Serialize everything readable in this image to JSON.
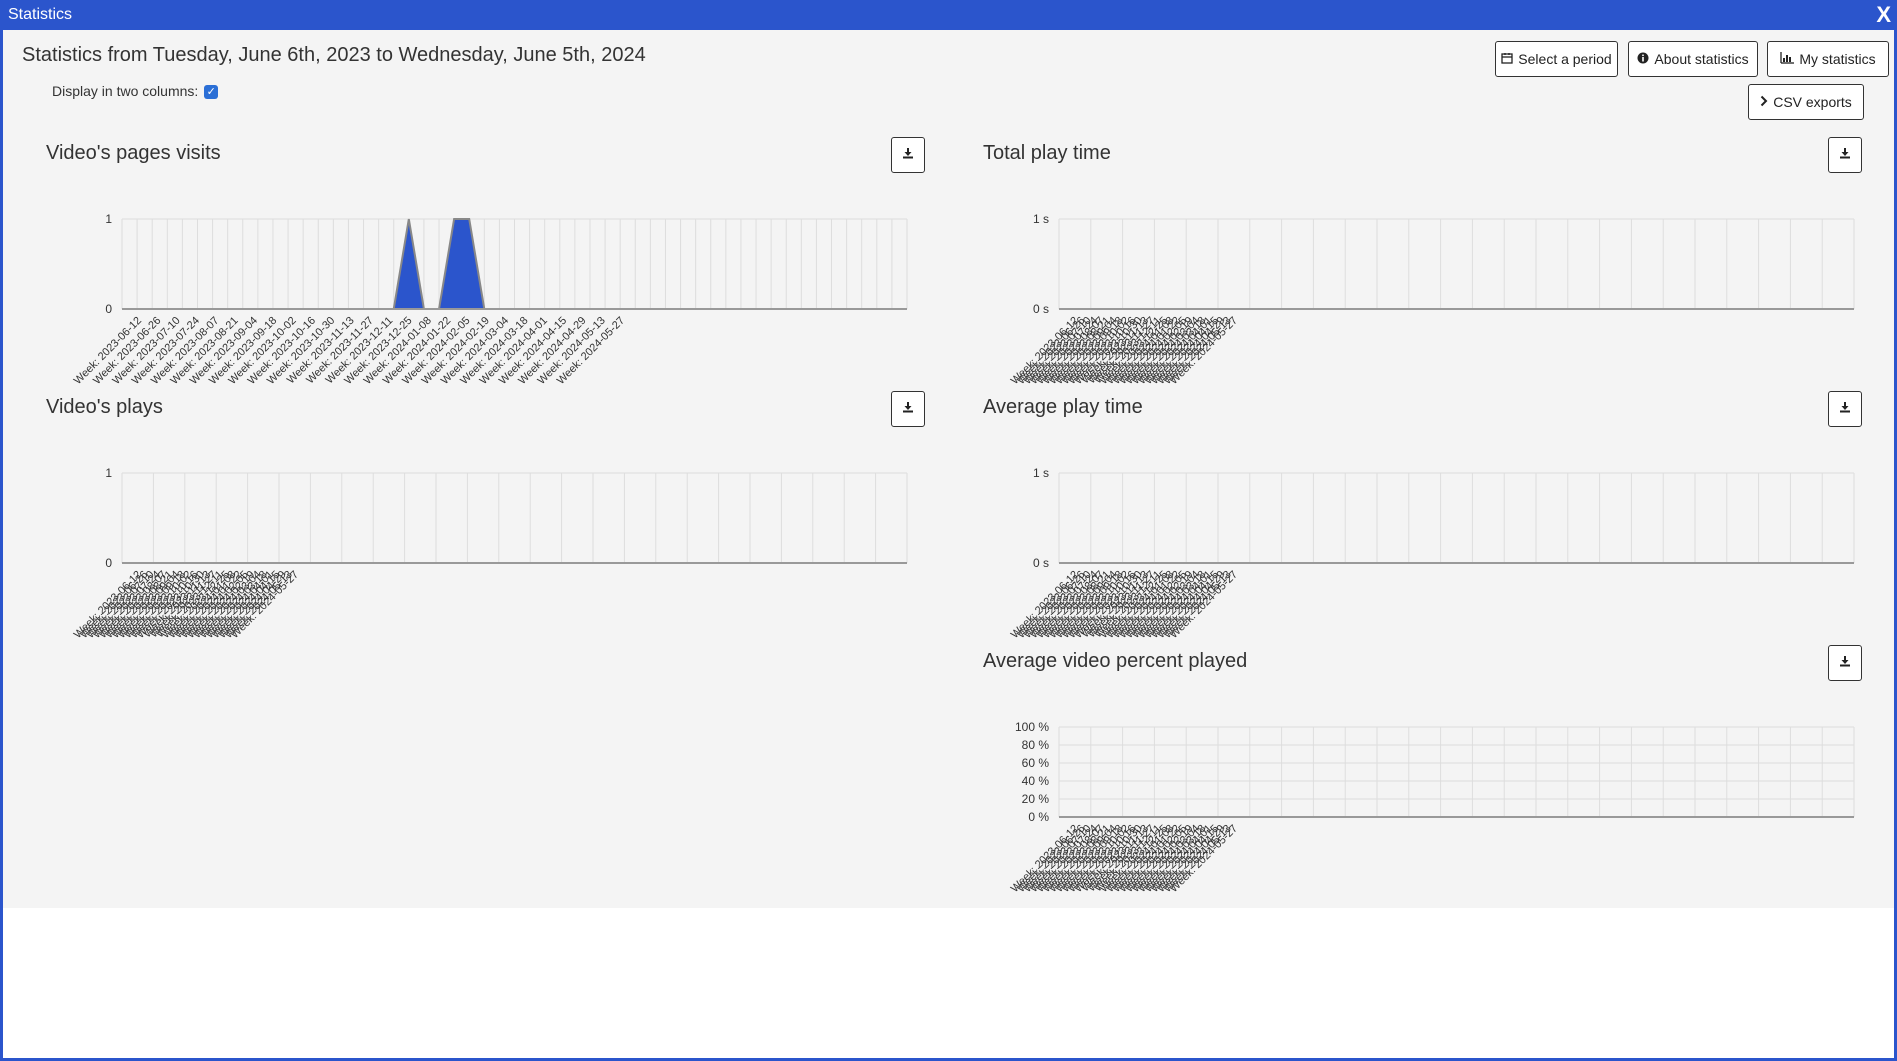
{
  "window": {
    "title": "Statistics",
    "close_label": "X"
  },
  "page": {
    "heading": "Statistics from Tuesday, June 6th, 2023 to Wednesday, June 5th, 2024",
    "two_columns_label": "Display in two columns:",
    "two_columns_checked": true
  },
  "buttons": {
    "select_period": "Select a period",
    "about_statistics": "About statistics",
    "my_statistics": "My statistics",
    "csv_exports": "CSV exports"
  },
  "icons": {
    "select_period": "calendar-icon",
    "about_statistics": "info-circle-icon",
    "my_statistics": "bar-chart-icon",
    "csv_exports": "chevron-right-icon",
    "download": "download-icon"
  },
  "colors": {
    "title_bar": "#2b55cc",
    "series_fill": "#2b55cc",
    "series_stroke": "#888888",
    "grid": "#dddddd",
    "axis": "#999999"
  },
  "chart_data": [
    {
      "id": "page-visits",
      "type": "area",
      "title": "Video's pages visits",
      "xlabel": "",
      "ylabel": "",
      "ylim": [
        0,
        1
      ],
      "yticks": [
        "0",
        "1"
      ],
      "x": [
        "Week: 2023-06-12",
        "Week: 2023-06-26",
        "Week: 2023-07-10",
        "Week: 2023-07-24",
        "Week: 2023-08-07",
        "Week: 2023-08-21",
        "Week: 2023-09-04",
        "Week: 2023-09-18",
        "Week: 2023-10-02",
        "Week: 2023-10-16",
        "Week: 2023-10-30",
        "Week: 2023-11-13",
        "Week: 2023-11-27",
        "Week: 2023-12-11",
        "Week: 2023-12-25",
        "Week: 2024-01-08",
        "Week: 2024-01-22",
        "Week: 2024-02-05",
        "Week: 2024-02-19",
        "Week: 2024-03-04",
        "Week: 2024-03-18",
        "Week: 2024-04-01",
        "Week: 2024-04-15",
        "Week: 2024-04-29",
        "Week: 2024-05-13",
        "Week: 2024-05-27"
      ],
      "series": [
        {
          "values": [
            0,
            0,
            0,
            0,
            0,
            0,
            0,
            0,
            0,
            0,
            0,
            0,
            0,
            0,
            0,
            0,
            0,
            0,
            0,
            1,
            0,
            0,
            1,
            1,
            0,
            0,
            0,
            0,
            0,
            0,
            0,
            0,
            0,
            0,
            0,
            0,
            0,
            0,
            0,
            0,
            0,
            0,
            0,
            0,
            0,
            0,
            0,
            0,
            0,
            0,
            0,
            0,
            0
          ]
        }
      ],
      "grid": true,
      "legend": "none"
    },
    {
      "id": "total-play-time",
      "type": "area",
      "title": "Total play time",
      "xlabel": "",
      "ylabel": "",
      "ylim": [
        0,
        1
      ],
      "yticks": [
        "0 s",
        "1 s"
      ],
      "x": [
        "Week: 2023-06-12",
        "Week: 2023-06-26",
        "Week: 2023-07-10",
        "Week: 2023-07-24",
        "Week: 2023-08-07",
        "Week: 2023-08-21",
        "Week: 2023-09-04",
        "Week: 2023-09-18",
        "Week: 2023-10-02",
        "Week: 2023-10-16",
        "Week: 2023-10-30",
        "Week: 2023-11-13",
        "Week: 2023-11-27",
        "Week: 2023-12-11",
        "Week: 2023-12-25",
        "Week: 2024-01-08",
        "Week: 2024-01-22",
        "Week: 2024-02-05",
        "Week: 2024-02-19",
        "Week: 2024-03-04",
        "Week: 2024-03-18",
        "Week: 2024-04-01",
        "Week: 2024-04-15",
        "Week: 2024-04-29",
        "Week: 2024-05-13",
        "Week: 2024-05-27"
      ],
      "series": [
        {
          "values": [
            0,
            0,
            0,
            0,
            0,
            0,
            0,
            0,
            0,
            0,
            0,
            0,
            0,
            0,
            0,
            0,
            0,
            0,
            0,
            0,
            0,
            0,
            0,
            0,
            0,
            0
          ]
        }
      ],
      "grid": true,
      "legend": "none"
    },
    {
      "id": "plays",
      "type": "area",
      "title": "Video's plays",
      "xlabel": "",
      "ylabel": "",
      "ylim": [
        0,
        1
      ],
      "yticks": [
        "0",
        "1"
      ],
      "x": [
        "Week: 2023-06-12",
        "Week: 2023-06-26",
        "Week: 2023-07-10",
        "Week: 2023-07-24",
        "Week: 2023-08-07",
        "Week: 2023-08-21",
        "Week: 2023-09-04",
        "Week: 2023-09-18",
        "Week: 2023-10-02",
        "Week: 2023-10-16",
        "Week: 2023-10-30",
        "Week: 2023-11-13",
        "Week: 2023-11-27",
        "Week: 2023-12-11",
        "Week: 2023-12-25",
        "Week: 2024-01-08",
        "Week: 2024-01-22",
        "Week: 2024-02-05",
        "Week: 2024-02-19",
        "Week: 2024-03-04",
        "Week: 2024-03-18",
        "Week: 2024-04-01",
        "Week: 2024-04-15",
        "Week: 2024-04-29",
        "Week: 2024-05-13",
        "Week: 2024-05-27"
      ],
      "series": [
        {
          "values": [
            0,
            0,
            0,
            0,
            0,
            0,
            0,
            0,
            0,
            0,
            0,
            0,
            0,
            0,
            0,
            0,
            0,
            0,
            0,
            0,
            0,
            0,
            0,
            0,
            0,
            0
          ]
        }
      ],
      "grid": true,
      "legend": "none"
    },
    {
      "id": "average-play-time",
      "type": "area",
      "title": "Average play time",
      "xlabel": "",
      "ylabel": "",
      "ylim": [
        0,
        1
      ],
      "yticks": [
        "0 s",
        "1 s"
      ],
      "x": [
        "Week: 2023-06-12",
        "Week: 2023-06-26",
        "Week: 2023-07-10",
        "Week: 2023-07-24",
        "Week: 2023-08-07",
        "Week: 2023-08-21",
        "Week: 2023-09-04",
        "Week: 2023-09-18",
        "Week: 2023-10-02",
        "Week: 2023-10-16",
        "Week: 2023-10-30",
        "Week: 2023-11-13",
        "Week: 2023-11-27",
        "Week: 2023-12-11",
        "Week: 2023-12-25",
        "Week: 2024-01-08",
        "Week: 2024-01-22",
        "Week: 2024-02-05",
        "Week: 2024-02-19",
        "Week: 2024-03-04",
        "Week: 2024-03-18",
        "Week: 2024-04-01",
        "Week: 2024-04-15",
        "Week: 2024-04-29",
        "Week: 2024-05-13",
        "Week: 2024-05-27"
      ],
      "series": [
        {
          "values": [
            0,
            0,
            0,
            0,
            0,
            0,
            0,
            0,
            0,
            0,
            0,
            0,
            0,
            0,
            0,
            0,
            0,
            0,
            0,
            0,
            0,
            0,
            0,
            0,
            0,
            0
          ]
        }
      ],
      "grid": true,
      "legend": "none"
    },
    {
      "id": "average-percent-played",
      "type": "area",
      "title": "Average video percent played",
      "xlabel": "",
      "ylabel": "",
      "ylim": [
        0,
        100
      ],
      "yticks": [
        "0 %",
        "20 %",
        "40 %",
        "60 %",
        "80 %",
        "100 %"
      ],
      "x": [
        "Week: 2023-06-12",
        "Week: 2023-06-26",
        "Week: 2023-07-10",
        "Week: 2023-07-24",
        "Week: 2023-08-07",
        "Week: 2023-08-21",
        "Week: 2023-09-04",
        "Week: 2023-09-18",
        "Week: 2023-10-02",
        "Week: 2023-10-16",
        "Week: 2023-10-30",
        "Week: 2023-11-13",
        "Week: 2023-11-27",
        "Week: 2023-12-11",
        "Week: 2023-12-25",
        "Week: 2024-01-08",
        "Week: 2024-01-22",
        "Week: 2024-02-05",
        "Week: 2024-02-19",
        "Week: 2024-03-04",
        "Week: 2024-03-18",
        "Week: 2024-04-01",
        "Week: 2024-04-15",
        "Week: 2024-04-29",
        "Week: 2024-05-13",
        "Week: 2024-05-27"
      ],
      "series": [
        {
          "values": [
            0,
            0,
            0,
            0,
            0,
            0,
            0,
            0,
            0,
            0,
            0,
            0,
            0,
            0,
            0,
            0,
            0,
            0,
            0,
            0,
            0,
            0,
            0,
            0,
            0,
            0
          ]
        }
      ],
      "grid": true,
      "legend": "none"
    }
  ]
}
